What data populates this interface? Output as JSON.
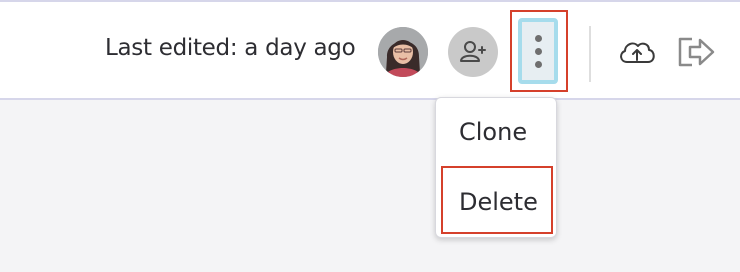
{
  "header": {
    "last_edited": "Last edited: a day ago"
  },
  "icons": {
    "avatar": "user-avatar",
    "add_user": "add-user-icon",
    "more": "more-vertical-icon",
    "upload": "cloud-upload-icon",
    "exit": "logout-icon"
  },
  "menu": {
    "items": [
      {
        "label": "Clone"
      },
      {
        "label": "Delete"
      }
    ]
  },
  "colors": {
    "highlight": "#d5402b",
    "active_button_border": "#a6dcec",
    "toolbar_border": "#d6d6ea"
  }
}
